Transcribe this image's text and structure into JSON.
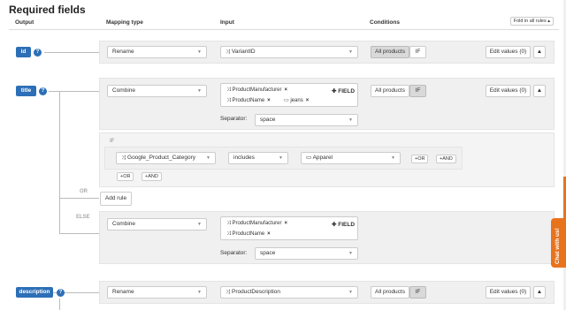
{
  "header": {
    "title": "Required fields",
    "fold_button": "Fold in all rules ▴"
  },
  "columns": {
    "output": "Output",
    "mapping": "Mapping type",
    "input": "Input",
    "conditions": "Conditions"
  },
  "rows": [
    {
      "field": "id",
      "mapping": "Rename",
      "input": "VariantID",
      "cond_all": "All products",
      "cond_if": "IF",
      "edit": "Edit values (0)"
    },
    {
      "field": "title",
      "mapping": "Combine",
      "tags": [
        {
          "label": "ProductManufacturer"
        },
        {
          "label": "ProductName"
        },
        {
          "label": "jeans"
        }
      ],
      "add_field": "FIELD",
      "separator_label": "Separator:",
      "separator": "space",
      "cond_all": "All products",
      "cond_if": "IF",
      "edit": "Edit values (0)"
    },
    {
      "field": "description",
      "mapping": "Rename",
      "input": "ProductDescription",
      "cond_all": "All products",
      "cond_if": "IF",
      "edit": "Edit values (0)"
    }
  ],
  "rule": {
    "if_label": "IF",
    "category": "Google_Product_Category",
    "operator": "includes",
    "value": "Apparel",
    "or": "OR",
    "and": "AND",
    "or_btn": "OR",
    "and_btn": "AND",
    "or_label": "OR",
    "add_rule": "Add rule",
    "else_label": "ELSE"
  },
  "else_combine": {
    "mapping": "Combine",
    "tags": [
      {
        "label": "ProductManufacturer"
      },
      {
        "label": "ProductName"
      }
    ],
    "add_field": "FIELD",
    "separator_label": "Separator:",
    "separator": "space"
  },
  "chat": {
    "label": "Chat with us!"
  },
  "colors": {
    "accent": "#2c6fb7",
    "chat": "#e8731d"
  }
}
